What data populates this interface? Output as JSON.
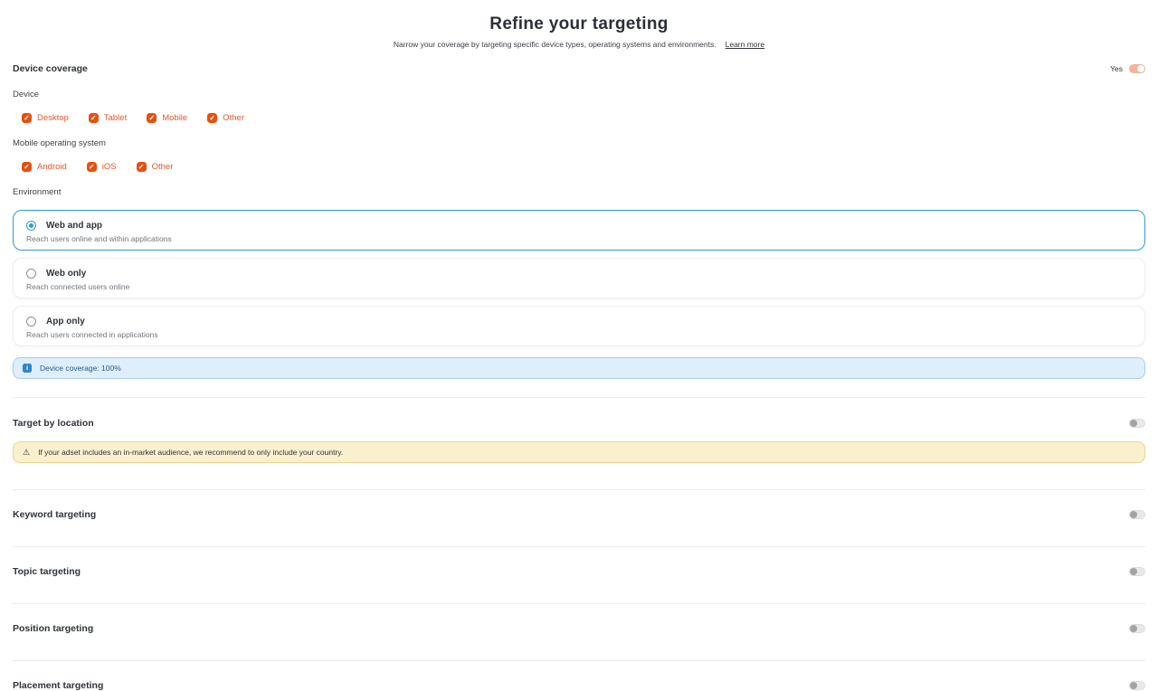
{
  "page": {
    "title": "Refine your targeting",
    "subtitle": "Narrow your coverage by targeting specific device types, operating systems and environments.",
    "learn_more": "Learn more"
  },
  "device_coverage": {
    "heading": "Device coverage",
    "toggle_label": "Yes",
    "toggle_state": "on",
    "device": {
      "label": "Device",
      "options": [
        {
          "label": "Desktop",
          "checked": true
        },
        {
          "label": "Tablet",
          "checked": true
        },
        {
          "label": "Mobile",
          "checked": true
        },
        {
          "label": "Other",
          "checked": true
        }
      ]
    },
    "mobile_os": {
      "label": "Mobile operating system",
      "options": [
        {
          "label": "Android",
          "checked": true
        },
        {
          "label": "iOS",
          "checked": true
        },
        {
          "label": "Other",
          "checked": true
        }
      ]
    },
    "environment": {
      "label": "Environment",
      "options": [
        {
          "title": "Web and app",
          "description": "Reach users online and within applications",
          "selected": true
        },
        {
          "title": "Web only",
          "description": "Reach connected users online",
          "selected": false
        },
        {
          "title": "App only",
          "description": "Reach users connected in applications",
          "selected": false
        }
      ]
    },
    "info_banner": {
      "icon": "info-icon",
      "text": "Device coverage: 100%"
    }
  },
  "location": {
    "heading": "Target by location",
    "toggle_state": "off",
    "warning": {
      "icon": "warning-icon",
      "text": "If your adset includes an in-market audience, we recommend to only include your country."
    }
  },
  "sections": [
    {
      "heading": "Keyword targeting",
      "toggle_state": "off"
    },
    {
      "heading": "Topic targeting",
      "toggle_state": "off"
    },
    {
      "heading": "Position targeting",
      "toggle_state": "off"
    },
    {
      "heading": "Placement targeting",
      "toggle_state": "off"
    }
  ],
  "icons": {
    "checkbox_check": "✓",
    "warning": "⚠",
    "info": "i"
  },
  "colors": {
    "accent_orange": "#E7500F",
    "checkbox_label_orange": "#E2572B",
    "accent_blue": "#2B9CD8",
    "info_banner_bg": "#DEEEFA",
    "info_banner_border": "#ABCDE9",
    "warning_banner_bg": "#FAF0CE",
    "warning_banner_border": "#E8D494",
    "toggle_on_track": "#F5B59B"
  }
}
